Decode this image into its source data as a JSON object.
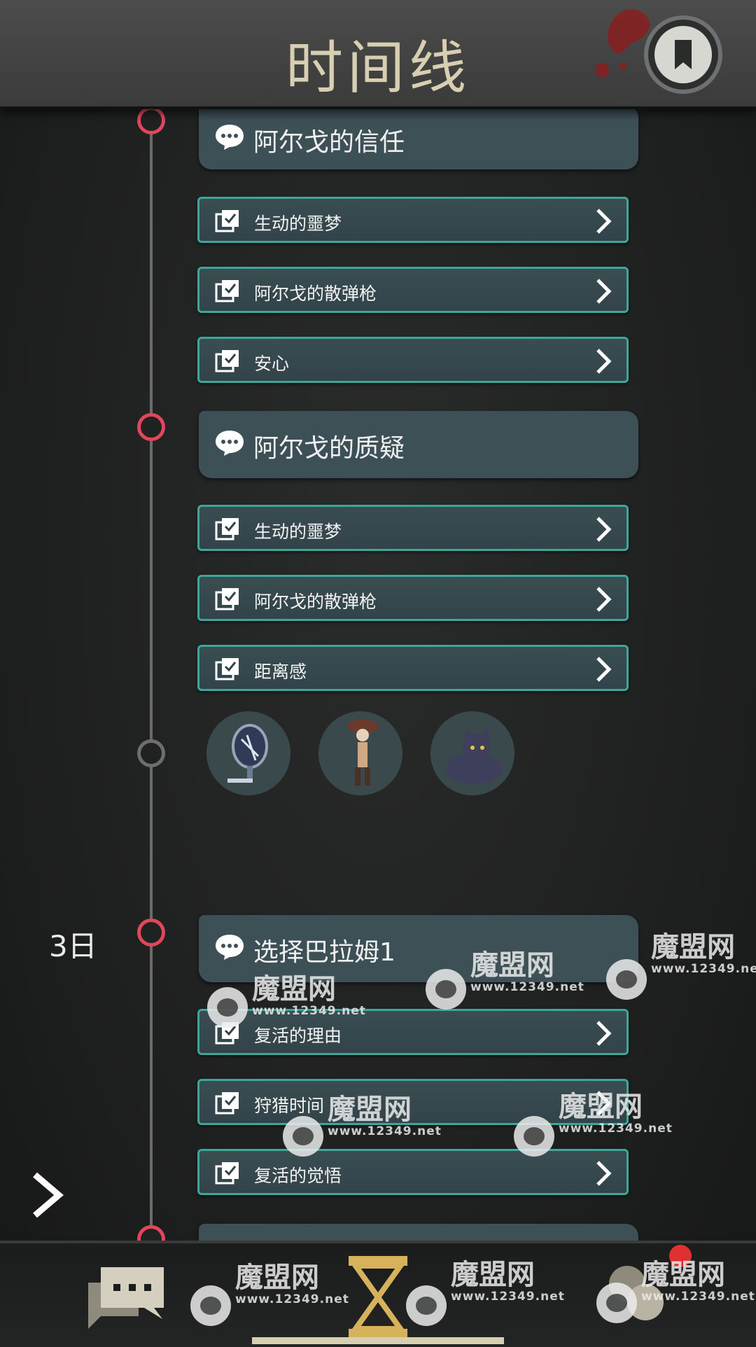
{
  "header": {
    "title": "时间线"
  },
  "day_label": "3日",
  "events": [
    {
      "title": "阿尔戈的信任",
      "choices": [
        "生动的噩梦",
        "阿尔戈的散弹枪",
        "安心"
      ]
    },
    {
      "title": "阿尔戈的质疑",
      "choices": [
        "生动的噩梦",
        "阿尔戈的散弹枪",
        "距离感"
      ]
    },
    {
      "title": "选择巴拉姆1",
      "choices": [
        "复活的理由",
        "狩猎时间",
        "复活的觉悟"
      ]
    }
  ],
  "characters": [
    "mirror",
    "long-haired-figure",
    "black-cat"
  ],
  "watermark": {
    "text": "魔盟网",
    "url": "www.12349.net"
  },
  "colors": {
    "accent_red": "#e0475a",
    "card_teal": "#3d5056",
    "choice_border": "#3fa69a",
    "title_cream": "#d8cfb2"
  }
}
